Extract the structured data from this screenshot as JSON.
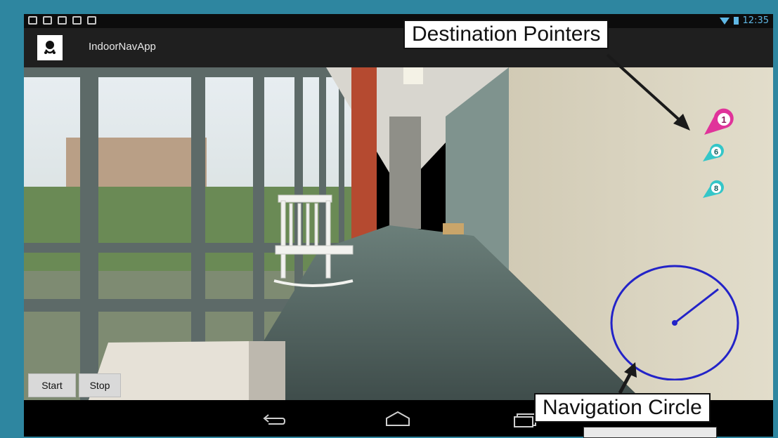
{
  "status_bar": {
    "time": "12:35",
    "icons": [
      "gallery-icon",
      "mail-icon",
      "dropbox-icon",
      "download-icon",
      "shopping-bag-icon"
    ],
    "accent_color": "#5fb7e4"
  },
  "action_bar": {
    "title": "IndoorNavApp",
    "icon": "app-logo-icon"
  },
  "camera_view": {
    "destination_pointers": [
      {
        "number": "1",
        "color": "#e0339a"
      },
      {
        "number": "6",
        "color": "#34c6c8"
      },
      {
        "number": "8",
        "color": "#34c6c8"
      }
    ],
    "navigation_circle": {
      "color": "#2323c8"
    }
  },
  "controls": {
    "start_label": "Start",
    "stop_label": "Stop"
  },
  "navigation_bar": {
    "buttons": [
      "back-icon",
      "home-icon",
      "recent-apps-icon"
    ]
  },
  "annotations": {
    "destination_pointers_label": "Destination Pointers",
    "navigation_circle_label": "Navigation Circle"
  }
}
